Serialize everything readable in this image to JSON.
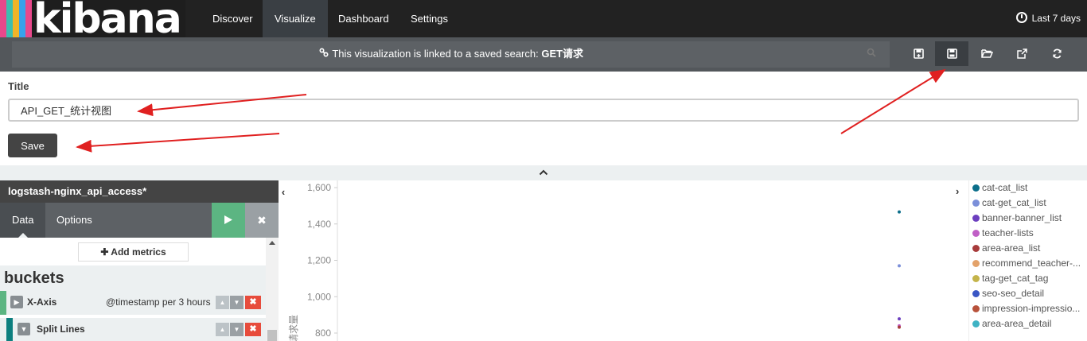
{
  "nav": {
    "logo_text": "kibana",
    "tabs": [
      {
        "label": "Discover"
      },
      {
        "label": "Visualize"
      },
      {
        "label": "Dashboard"
      },
      {
        "label": "Settings"
      }
    ],
    "active_tab": "Visualize",
    "time_label": "Last 7 days"
  },
  "toolbar": {
    "link_message": "This visualization is linked to a saved search: ",
    "saved_search_name": "GET请求"
  },
  "save_form": {
    "title_label": "Title",
    "title_value": "API_GET_统计视图",
    "save_label": "Save"
  },
  "sidebar": {
    "index_pattern": "logstash-nginx_api_access*",
    "tabs": [
      {
        "label": "Data"
      },
      {
        "label": "Options"
      }
    ],
    "add_metrics_label": "Add metrics",
    "buckets_title": "buckets",
    "aggregations": [
      {
        "name": "X-Axis",
        "description": "@timestamp per 3 hours",
        "color": "#5cb582"
      },
      {
        "name": "Split Lines",
        "description": "",
        "color": "#0d7f7f"
      }
    ]
  },
  "chart_data": {
    "type": "line",
    "ylabel": "请求量",
    "y_ticks": [
      "1,600",
      "1,400",
      "1,200",
      "1,000",
      "800"
    ],
    "ylim_visible": [
      800,
      1600
    ],
    "series": [
      {
        "name": "cat-cat_list",
        "color": "#0b6e8a",
        "points": [
          1466
        ]
      },
      {
        "name": "cat-get_cat_list",
        "color": "#7b8fd9",
        "points": [
          1170
        ]
      },
      {
        "name": "banner-banner_list",
        "color": "#6c3fbf",
        "points": [
          878
        ]
      },
      {
        "name": "teacher-lists",
        "color": "#c05fc6",
        "points": [
          840
        ]
      },
      {
        "name": "area-area_list",
        "color": "#a73b3b",
        "points": [
          832
        ]
      },
      {
        "name": "recommend_teacher-...",
        "color": "#e3a26a",
        "points": []
      },
      {
        "name": "tag-get_cat_tag",
        "color": "#c4b44a",
        "points": []
      },
      {
        "name": "seo-seo_detail",
        "color": "#3a56c4",
        "points": []
      },
      {
        "name": "impression-impressio...",
        "color": "#b8523b",
        "points": []
      },
      {
        "name": "area-area_detail",
        "color": "#3fb3c4",
        "points": []
      }
    ]
  },
  "colors": {
    "nav_bg": "#222222",
    "toolbar_bg": "#53575b",
    "apply_green": "#5cb582",
    "remove_red": "#e74c3c",
    "annotation_red": "#e02020"
  },
  "icons": {
    "link": "link-icon",
    "new": "new-visualization-icon",
    "save": "save-icon",
    "open": "open-folder-icon",
    "share": "share-icon",
    "refresh": "refresh-icon"
  }
}
